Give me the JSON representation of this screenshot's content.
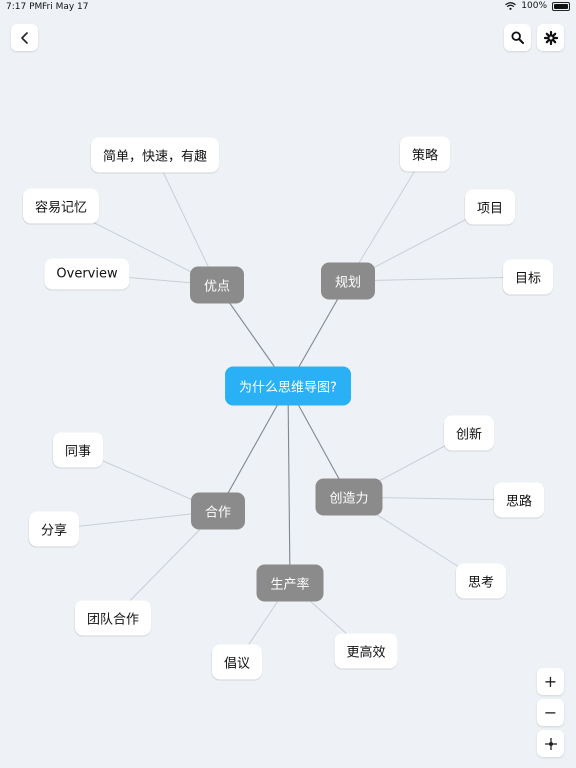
{
  "status": {
    "time": "7:17 PM",
    "date": "Fri May 17",
    "battery": "100%"
  },
  "toolbar": {
    "back_icon": "chevron-left-icon",
    "search_icon": "search-icon",
    "settings_icon": "gear-icon"
  },
  "mindmap": {
    "root": "为什么思维导图?",
    "branches": {
      "advantages": {
        "label": "优点",
        "children": {
          "simple": "简单，快速，有趣",
          "memorable": "容易记忆",
          "overview": "Overview"
        }
      },
      "planning": {
        "label": "规划",
        "children": {
          "strategy": "策略",
          "project": "项目",
          "goal": "目标"
        }
      },
      "creativity": {
        "label": "创造力",
        "children": {
          "innovation": "创新",
          "thinking_path": "思路",
          "thinking": "思考"
        }
      },
      "cooperation": {
        "label": "合作",
        "children": {
          "colleague": "同事",
          "share": "分享",
          "teamwork": "团队合作"
        }
      },
      "productivity": {
        "label": "生产率",
        "children": {
          "propose": "倡议",
          "efficient": "更高效"
        }
      }
    }
  },
  "zoom": {
    "in": "+",
    "out": "−"
  }
}
